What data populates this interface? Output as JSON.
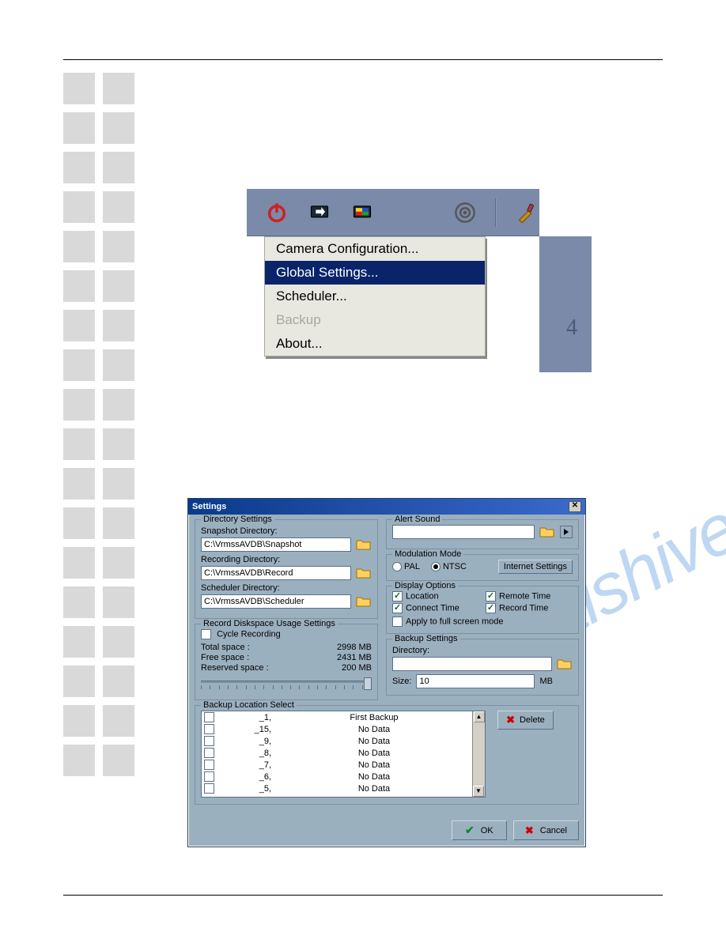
{
  "watermark": "manualshive.com",
  "top_menu": {
    "items": [
      {
        "label": "Camera Configuration...",
        "highlight": false,
        "disabled": false
      },
      {
        "label": "Global Settings...",
        "highlight": true,
        "disabled": false
      },
      {
        "label": "Scheduler...",
        "highlight": false,
        "disabled": false
      },
      {
        "label": "Backup",
        "highlight": false,
        "disabled": true
      },
      {
        "label": "About...",
        "highlight": false,
        "disabled": false
      }
    ],
    "behind_text": "4"
  },
  "dialog": {
    "title": "Settings",
    "directory_settings": {
      "group": "Directory Settings",
      "snapshot_label": "Snapshot Directory:",
      "snapshot_value": "C:\\VrmssAVDB\\Snapshot",
      "recording_label": "Recording Directory:",
      "recording_value": "C:\\VrmssAVDB\\Record",
      "scheduler_label": "Scheduler Directory:",
      "scheduler_value": "C:\\VrmssAVDB\\Scheduler"
    },
    "diskspace": {
      "group": "Record Diskspace Usage Settings",
      "cycle_label": "Cycle Recording",
      "cycle_checked": false,
      "total_label": "Total space :",
      "total_value": "2998 MB",
      "free_label": "Free space :",
      "free_value": "2431 MB",
      "reserved_label": "Reserved space :",
      "reserved_value": "200 MB"
    },
    "alert_sound": {
      "group": "Alert Sound",
      "value": ""
    },
    "modulation": {
      "group": "Modulation Mode",
      "pal_label": "PAL",
      "ntsc_label": "NTSC",
      "selected": "NTSC",
      "internet_btn": "Internet Settings"
    },
    "display_options": {
      "group": "Display Options",
      "location_label": "Location",
      "location_checked": true,
      "remote_label": "Remote Time",
      "remote_checked": true,
      "connect_label": "Connect Time",
      "connect_checked": true,
      "record_label": "Record Time",
      "record_checked": true,
      "fullscreen_label": "Apply to full screen mode",
      "fullscreen_checked": false
    },
    "backup_settings": {
      "group": "Backup Settings",
      "dir_label": "Directory:",
      "dir_value": "",
      "size_label": "Size:",
      "size_value": "10",
      "size_unit": "MB"
    },
    "backup_location": {
      "group": "Backup Location Select",
      "rows": [
        {
          "c1": "_1,",
          "c2": "First Backup"
        },
        {
          "c1": "_15,",
          "c2": "No Data"
        },
        {
          "c1": "_9,",
          "c2": "No Data"
        },
        {
          "c1": "_8,",
          "c2": "No Data"
        },
        {
          "c1": "_7,",
          "c2": "No Data"
        },
        {
          "c1": "_6,",
          "c2": "No Data"
        },
        {
          "c1": "_5,",
          "c2": "No Data"
        }
      ],
      "delete_label": "Delete"
    },
    "footer": {
      "ok": "OK",
      "cancel": "Cancel"
    }
  }
}
